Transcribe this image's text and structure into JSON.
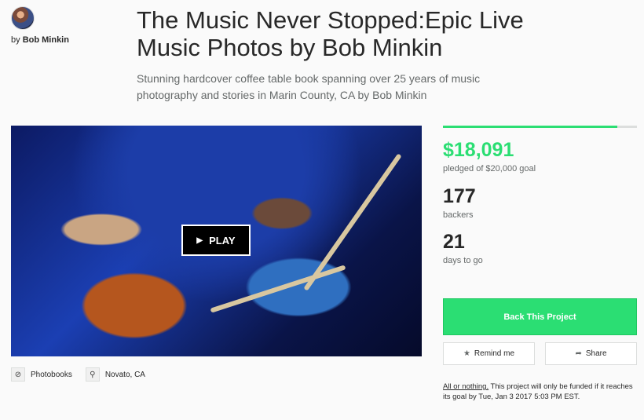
{
  "creator": {
    "by_prefix": "by",
    "name": "Bob Minkin"
  },
  "project": {
    "title": "The Music Never Stopped:Epic Live Music Photos by Bob Minkin",
    "blurb": "Stunning hardcover coffee table book spanning over 25 years of music photography and stories in Marin County, CA by Bob Minkin"
  },
  "video": {
    "play_label": "PLAY",
    "play_icon": "play-triangle-icon"
  },
  "meta": {
    "category": "Photobooks",
    "category_icon": "compass-icon",
    "location": "Novato, CA",
    "location_icon": "map-pin-icon"
  },
  "stats": {
    "progress_fraction": 0.9,
    "pledged": "$18,091",
    "pledged_label": "pledged of $20,000 goal",
    "backers": "177",
    "backers_label": "backers",
    "days": "21",
    "days_label": "days to go"
  },
  "actions": {
    "back_label": "Back This Project",
    "remind_label": "Remind me",
    "remind_icon": "star-icon",
    "share_label": "Share",
    "share_icon": "share-arrow-icon"
  },
  "funding": {
    "link_text": "All or nothing.",
    "note": " This project will only be funded if it reaches its goal by Tue, Jan 3 2017 5:03 PM EST."
  },
  "colors": {
    "accent": "#2bde73",
    "text": "#282828",
    "muted": "#656969"
  }
}
